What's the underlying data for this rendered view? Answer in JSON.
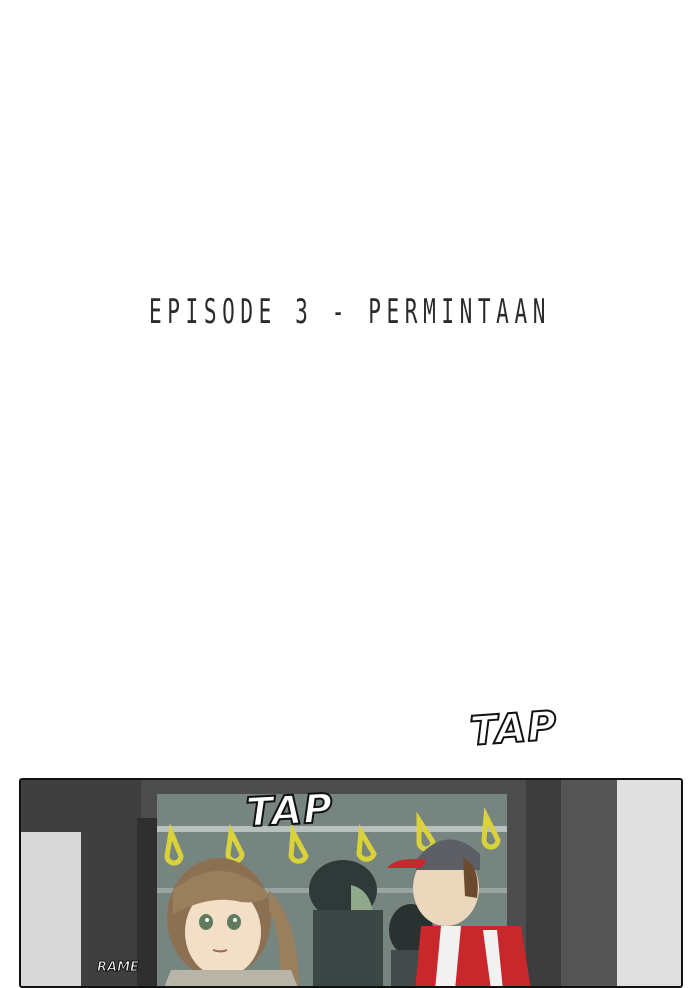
{
  "episode": {
    "title": "EPISODE 3 - PERMINTAAN"
  },
  "sound_effects": {
    "tap_top": "TAP",
    "tap_panel": "TAP",
    "rame": "RAME"
  },
  "colors": {
    "background": "#ffffff",
    "title_text": "#2b2b2b",
    "panel_border": "#111111",
    "cap_red": "#c8282c",
    "strap_yellow": "#d9d23a"
  },
  "icons": {
    "panel": "train-interior-illustration"
  }
}
